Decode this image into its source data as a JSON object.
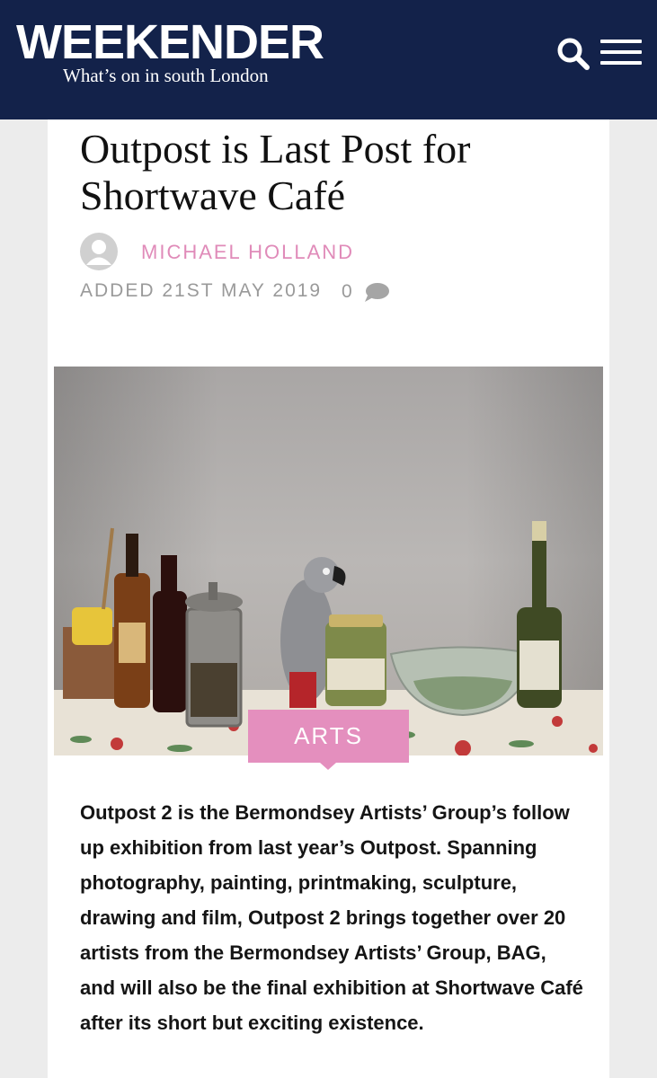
{
  "header": {
    "logo_title": "WEEKENDER",
    "logo_subtitle": "What’s on in south London",
    "search_icon": "search-icon",
    "menu_icon": "hamburger-menu-icon",
    "background_color": "#13224a"
  },
  "article": {
    "title": "Outpost is Last Post for Shortwave Café",
    "author": "MICHAEL HOLLAND",
    "date": "ADDED 21ST MAY 2019",
    "comment_count": "0",
    "category": "ARTS",
    "accent_color": "#e48fbe",
    "body": "Outpost 2 is the Bermondsey Artists’ Group’s follow up exhibition from last year’s Outpost. Spanning photography, painting, printmaking, sculpture, drawing and film, Outpost 2 brings together over 20 artists from the Bermondsey Artists’ Group, BAG, and will also be the final exhibition at Shortwave Café after its short but exciting existence."
  }
}
